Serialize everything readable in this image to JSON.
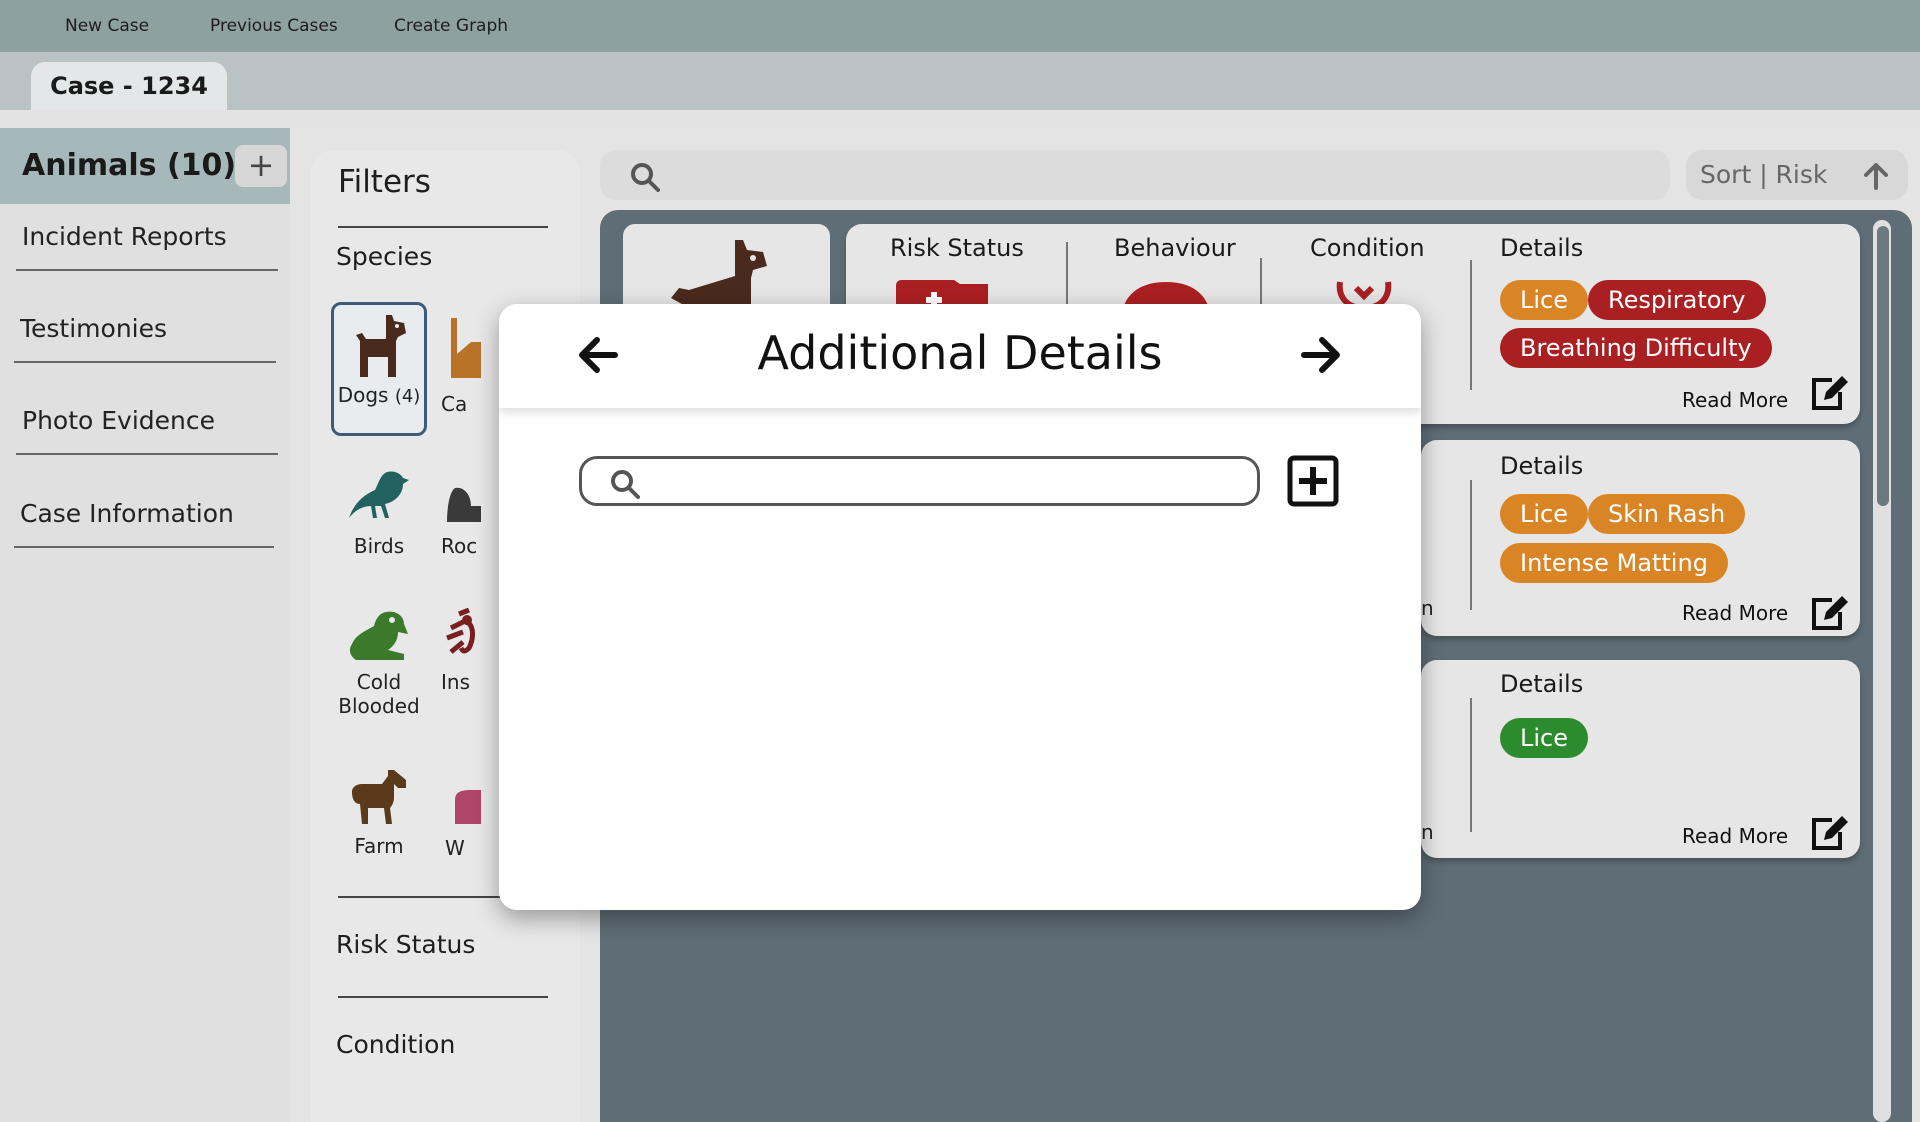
{
  "topnav": {
    "new_case": "New Case",
    "previous_cases": "Previous Cases",
    "create_graph": "Create Graph"
  },
  "case_tab": "Case - 1234",
  "sidebar": {
    "title": "Animals (10)",
    "add_label": "+",
    "items": [
      {
        "label": "Incident Reports"
      },
      {
        "label": "Testimonies"
      },
      {
        "label": "Photo Evidence"
      },
      {
        "label": "Case Information"
      }
    ]
  },
  "filters": {
    "title": "Filters",
    "species_heading": "Species",
    "species": [
      {
        "label": "Dogs",
        "count": "(4)",
        "icon": "dog-icon",
        "color": "#4a2a1c"
      },
      {
        "label": "Ca",
        "icon": "cat-icon",
        "color": "#b87328"
      },
      {
        "label": "Birds",
        "icon": "bird-icon",
        "color": "#21625f"
      },
      {
        "label": "Roc",
        "icon": "rodent-icon",
        "color": "#3a3a3a"
      },
      {
        "label": "Cold",
        "label2": "Blooded",
        "icon": "frog-icon",
        "color": "#3a7a2a"
      },
      {
        "label": "Ins",
        "icon": "insect-icon",
        "color": "#7a1e1e"
      },
      {
        "label": "Farm",
        "icon": "horse-icon",
        "color": "#5a3a1a"
      },
      {
        "label": "W",
        "icon": "wild-icon",
        "color": "#b0456a"
      }
    ],
    "risk_heading": "Risk  Status",
    "condition_heading": "Condition"
  },
  "sort": {
    "label": "Sort | Risk"
  },
  "cards": [
    {
      "headers": {
        "risk": "Risk Status",
        "behaviour": "Behaviour",
        "condition": "Condition",
        "details": "Details"
      },
      "tags": [
        {
          "label": "Lice",
          "severity": "orange"
        },
        {
          "label": "Respiratory",
          "severity": "red"
        },
        {
          "label": "Breathing Difficulty",
          "severity": "red"
        }
      ],
      "read_more": "Read More"
    },
    {
      "headers": {
        "details": "Details"
      },
      "partial_text": "n",
      "tags": [
        {
          "label": "Lice",
          "severity": "orange"
        },
        {
          "label": "Skin Rash",
          "severity": "orange"
        },
        {
          "label": "Intense Matting",
          "severity": "orange"
        }
      ],
      "read_more": "Read More"
    },
    {
      "headers": {
        "details": "Details"
      },
      "partial_text": "n",
      "tags": [
        {
          "label": "Lice",
          "severity": "green"
        }
      ],
      "read_more": "Read More"
    }
  ],
  "colors": {
    "orange": "#d98526",
    "red": "#aa1f22",
    "green": "#2c8b2c",
    "accent_teal": "#8fa0a1"
  },
  "modal": {
    "title": "Additional Details",
    "search_value": "",
    "prev_icon": "arrow-left-icon",
    "next_icon": "arrow-right-icon",
    "add_icon": "plus-square-icon"
  }
}
